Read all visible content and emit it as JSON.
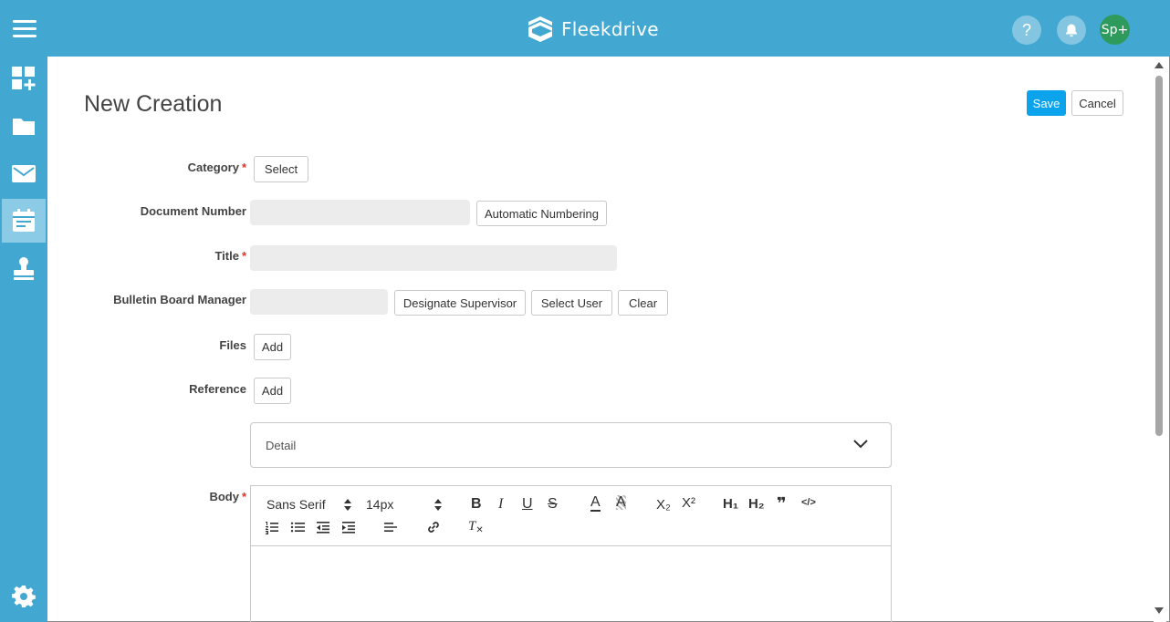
{
  "app": {
    "brand": "Fleekdrive",
    "help_symbol": "?",
    "avatar_initials": "Sp+",
    "colors": {
      "header": "#42a8d2",
      "save": "#0aa3ec",
      "avatar": "#2e9a5b",
      "required": "#e0312a"
    }
  },
  "sidebar": {
    "items": [
      {
        "icon": "dashboard-add-icon"
      },
      {
        "icon": "folder-icon"
      },
      {
        "icon": "mail-icon"
      },
      {
        "icon": "bulletin-board-icon",
        "active": true
      },
      {
        "icon": "stamp-icon"
      },
      {
        "icon": "gear-icon"
      }
    ]
  },
  "page": {
    "title": "New Creation",
    "save_label": "Save",
    "cancel_label": "Cancel"
  },
  "form": {
    "required_mark": "*",
    "category": {
      "label": "Category",
      "button": "Select"
    },
    "document_number": {
      "label": "Document Number",
      "value": "",
      "button": "Automatic Numbering"
    },
    "title": {
      "label": "Title",
      "value": ""
    },
    "manager": {
      "label": "Bulletin Board Manager",
      "value": "",
      "designate": "Designate Supervisor",
      "select_user": "Select User",
      "clear": "Clear"
    },
    "files": {
      "label": "Files",
      "button": "Add"
    },
    "reference": {
      "label": "Reference",
      "button": "Add"
    },
    "detail": {
      "label": "Detail"
    },
    "body": {
      "label": "Body"
    }
  },
  "editor": {
    "font": "Sans Serif",
    "size": "14px",
    "bold": "B",
    "italic": "I",
    "underline": "U",
    "strike": "S",
    "color": "A",
    "background": "A",
    "subscript": "X₂",
    "superscript": "X²",
    "h1": "H₁",
    "h2": "H₂",
    "blockquote": "❞",
    "code": "</>",
    "clear_format": "T"
  }
}
